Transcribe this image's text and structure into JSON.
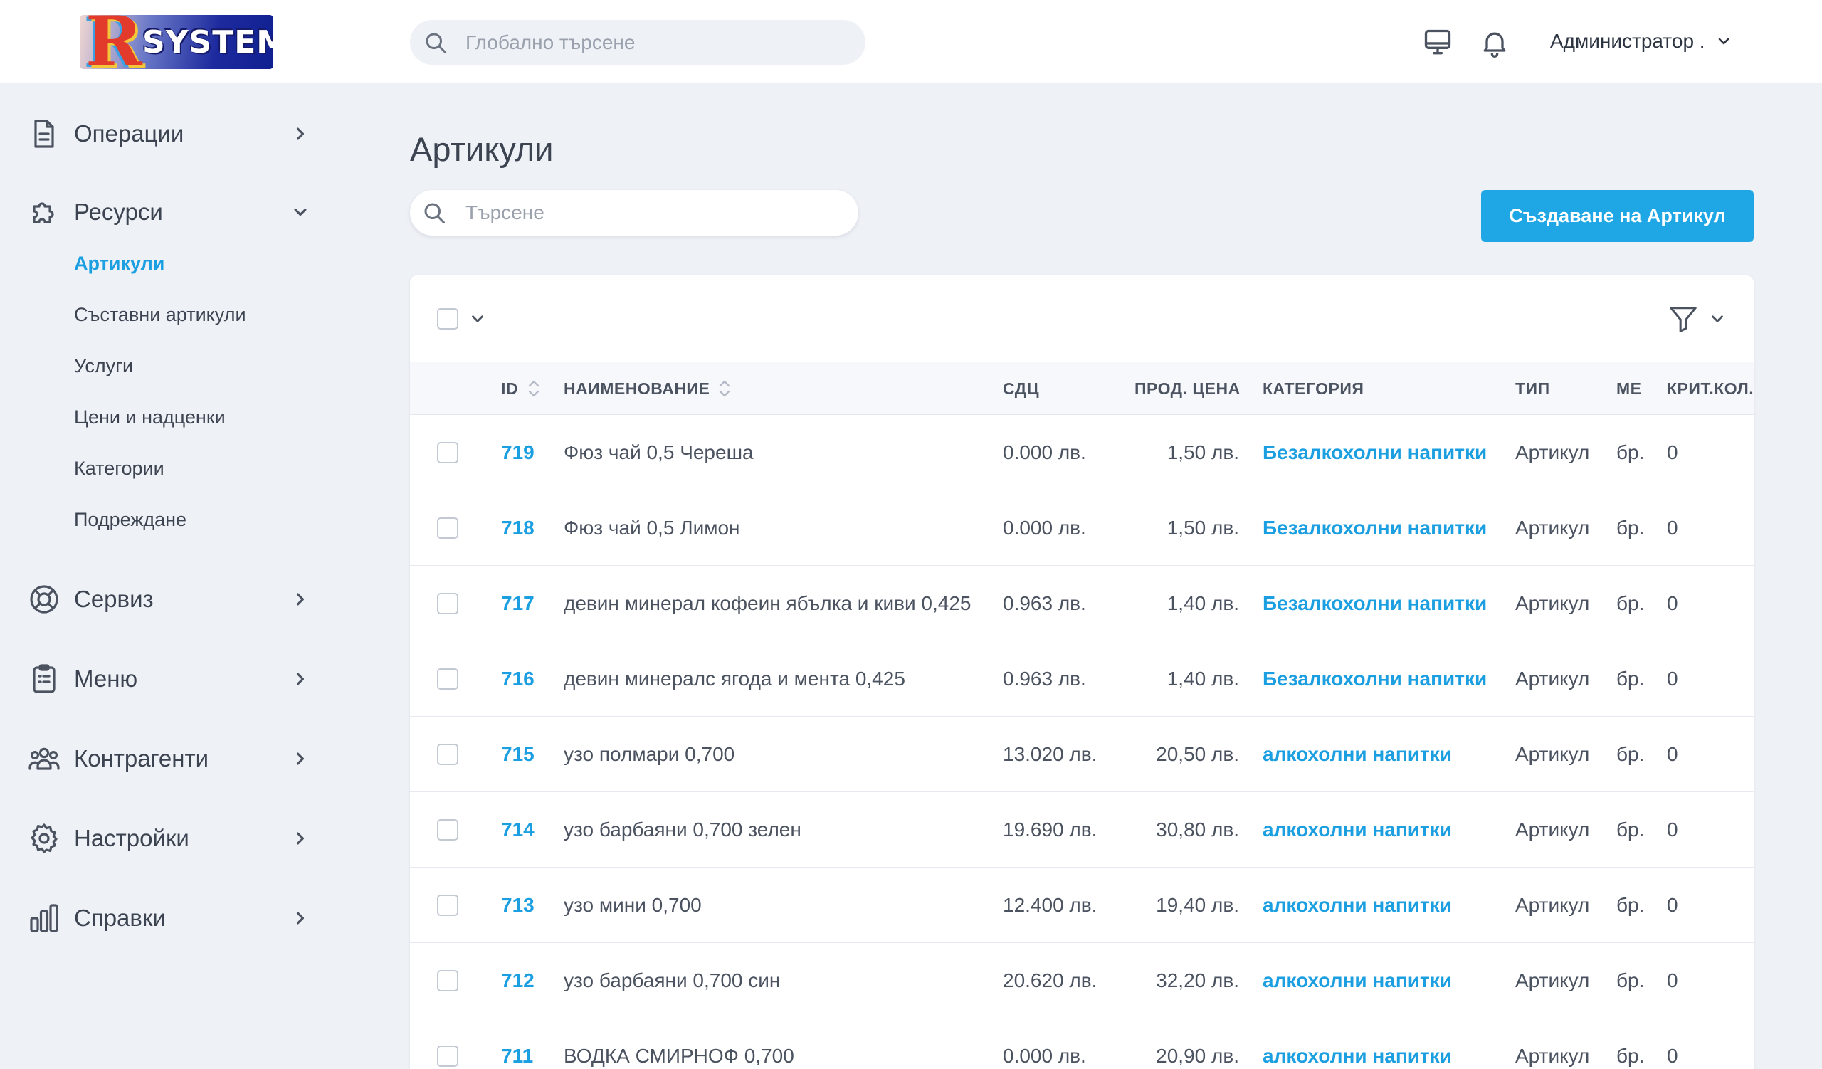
{
  "header": {
    "logo_text": "SYSTEM",
    "logo_letter": "R",
    "global_search_placeholder": "Глобално търсене",
    "user_name": "Администратор ."
  },
  "sidebar": {
    "items": [
      {
        "label": "Операции",
        "icon": "document-icon"
      },
      {
        "label": "Ресурси",
        "icon": "puzzle-icon",
        "expanded": true
      },
      {
        "label": "Сервиз",
        "icon": "lifebuoy-icon"
      },
      {
        "label": "Меню",
        "icon": "clipboard-icon"
      },
      {
        "label": "Контрагенти",
        "icon": "users-icon"
      },
      {
        "label": "Настройки",
        "icon": "gear-icon"
      },
      {
        "label": "Справки",
        "icon": "bar-chart-icon"
      }
    ],
    "subitems": [
      {
        "label": "Артикули",
        "active": true
      },
      {
        "label": "Съставни артикули"
      },
      {
        "label": "Услуги"
      },
      {
        "label": "Цени и надценки"
      },
      {
        "label": "Категории"
      },
      {
        "label": "Подреждане"
      }
    ]
  },
  "main": {
    "title": "Артикули",
    "search_placeholder": "Търсене",
    "create_button": "Създаване на Артикул"
  },
  "table": {
    "columns": [
      "ID",
      "НАИМЕНОВАНИЕ",
      "СДЦ",
      "ПРОД. ЦЕНА",
      "КАТЕГОРИЯ",
      "ТИП",
      "МЕ",
      "КРИТ.КОЛ."
    ],
    "rows": [
      {
        "id": "719",
        "name": "Фюз чай 0,5 Череша",
        "sdc": "0.000 лв.",
        "price": "1,50 лв.",
        "category": "Безалкохолни напитки",
        "type": "Артикул",
        "unit": "бр.",
        "crit": "0"
      },
      {
        "id": "718",
        "name": "Фюз чай 0,5 Лимон",
        "sdc": "0.000 лв.",
        "price": "1,50 лв.",
        "category": "Безалкохолни напитки",
        "type": "Артикул",
        "unit": "бр.",
        "crit": "0"
      },
      {
        "id": "717",
        "name": "девин минерал кофеин ябълка и киви 0,425",
        "sdc": "0.963 лв.",
        "price": "1,40 лв.",
        "category": "Безалкохолни напитки",
        "type": "Артикул",
        "unit": "бр.",
        "crit": "0"
      },
      {
        "id": "716",
        "name": "девин минералс ягода и мента 0,425",
        "sdc": "0.963 лв.",
        "price": "1,40 лв.",
        "category": "Безалкохолни напитки",
        "type": "Артикул",
        "unit": "бр.",
        "crit": "0"
      },
      {
        "id": "715",
        "name": "узо полмари 0,700",
        "sdc": "13.020 лв.",
        "price": "20,50 лв.",
        "category": "алкохолни напитки",
        "type": "Артикул",
        "unit": "бр.",
        "crit": "0"
      },
      {
        "id": "714",
        "name": "узо барбаяни 0,700 зелен",
        "sdc": "19.690 лв.",
        "price": "30,80 лв.",
        "category": "алкохолни напитки",
        "type": "Артикул",
        "unit": "бр.",
        "crit": "0"
      },
      {
        "id": "713",
        "name": "узо мини 0,700",
        "sdc": "12.400 лв.",
        "price": "19,40 лв.",
        "category": "алкохолни напитки",
        "type": "Артикул",
        "unit": "бр.",
        "crit": "0"
      },
      {
        "id": "712",
        "name": "узо барбаяни 0,700 син",
        "sdc": "20.620 лв.",
        "price": "32,20 лв.",
        "category": "алкохолни напитки",
        "type": "Артикул",
        "unit": "бр.",
        "crit": "0"
      },
      {
        "id": "711",
        "name": "ВОДКА СМИРНОФ 0,700",
        "sdc": "0.000 лв.",
        "price": "20,90 лв.",
        "category": "алкохолни напитки",
        "type": "Артикул",
        "unit": "бр.",
        "crit": "0"
      }
    ]
  },
  "colors": {
    "accent": "#1fa7e5",
    "link": "#1b9fe0",
    "background": "#eef1f6",
    "text": "#3d4451"
  }
}
